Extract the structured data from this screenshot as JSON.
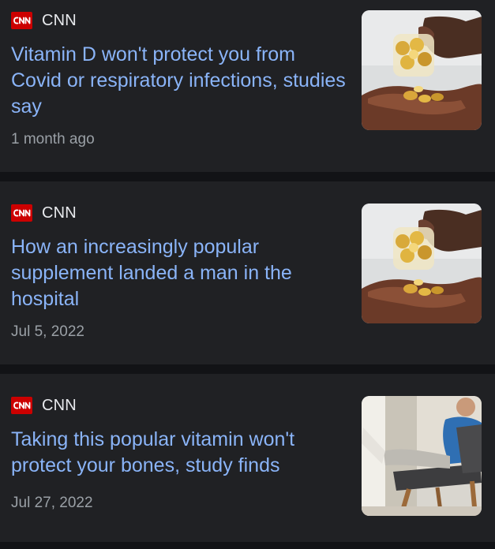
{
  "articles": [
    {
      "source": "CNN",
      "source_logo_text": "CNN",
      "headline": "Vitamin D won't protect you from Covid or respiratory infections, studies say",
      "time": "1 month ago",
      "thumbnail_icon": "vitamin-capsules-in-hand"
    },
    {
      "source": "CNN",
      "source_logo_text": "CNN",
      "headline": "How an increasingly popular supplement landed a man in the hospital",
      "time": "Jul 5, 2022",
      "thumbnail_icon": "vitamin-capsules-in-hand"
    },
    {
      "source": "CNN",
      "source_logo_text": "CNN",
      "headline": "Taking this popular vitamin won't protect your bones, study finds",
      "time": "Jul 27, 2022",
      "thumbnail_icon": "person-in-chair"
    }
  ],
  "colors": {
    "card_bg": "#202124",
    "page_bg": "#121316",
    "headline": "#8ab4f8",
    "source_text": "#e8eaed",
    "timestamp": "#9aa0a6",
    "cnn_red": "#cc0000"
  }
}
